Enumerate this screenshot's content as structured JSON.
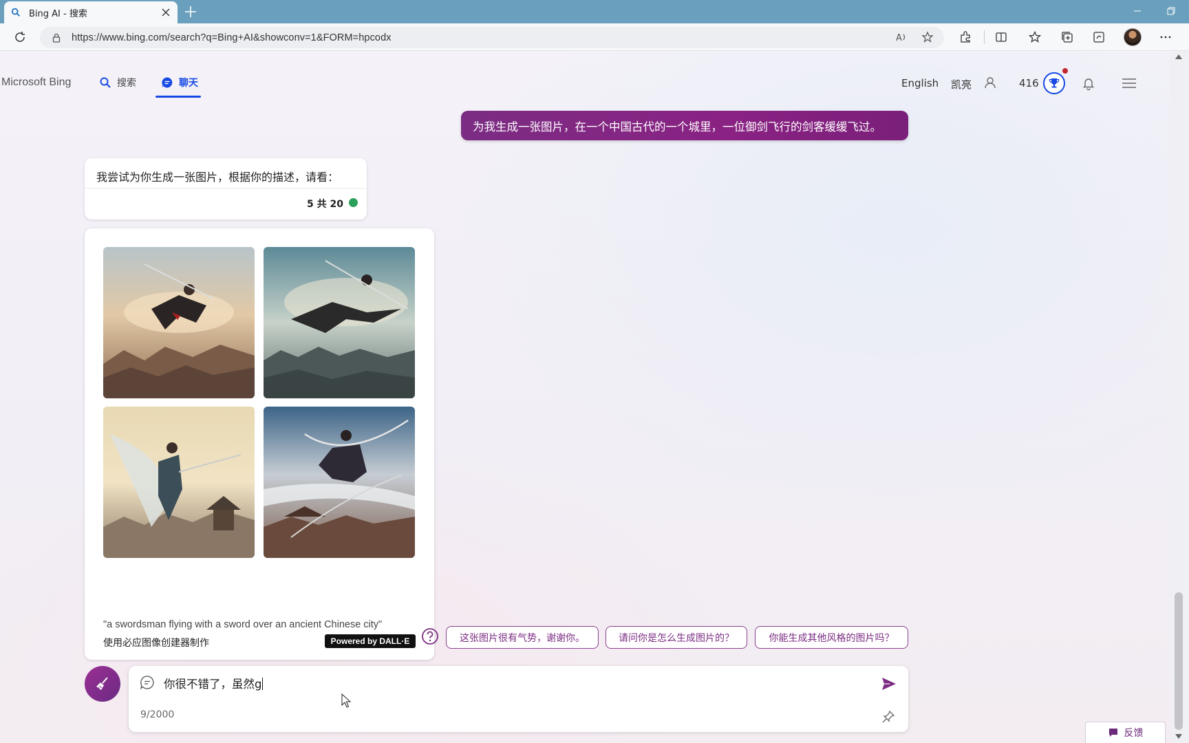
{
  "browser": {
    "tab_title": "Bing AI - 搜索",
    "url": "https://www.bing.com/search?q=Bing+AI&showconv=1&FORM=hpcodx"
  },
  "header": {
    "brand": "Microsoft Bing",
    "nav": [
      {
        "label": "搜索",
        "icon": "search-icon",
        "active": false
      },
      {
        "label": "聊天",
        "icon": "chat-icon",
        "active": true
      }
    ],
    "language": "English",
    "user_name": "凯亮",
    "reward_points": "416"
  },
  "conversation": {
    "user_message": "为我生成一张图片，在一个中国古代的一个城里，一位御剑飞行的剑客缓缓飞过。",
    "bot_message": "我尝试为你生成一张图片，根据你的描述，请看：",
    "turn_counter": "5 共 20",
    "image_card": {
      "prompt": "\"a swordsman flying with a sword over an ancient Chinese city\"",
      "creator_label": "使用必应图像创建器制作",
      "badge": "Powered by DALL·E",
      "image_count": 4
    }
  },
  "suggestions": [
    "这张图片很有气势，谢谢你。",
    "请问你是怎么生成图片的？",
    "你能生成其他风格的图片吗？"
  ],
  "composer": {
    "input_value": "你很不错了，虽然g",
    "char_count": "9/2000"
  },
  "feedback_label": "反馈",
  "colors": {
    "accent_purple": "#7b2c83",
    "nav_active_blue": "#174ae4",
    "status_green": "#2aa05a"
  }
}
